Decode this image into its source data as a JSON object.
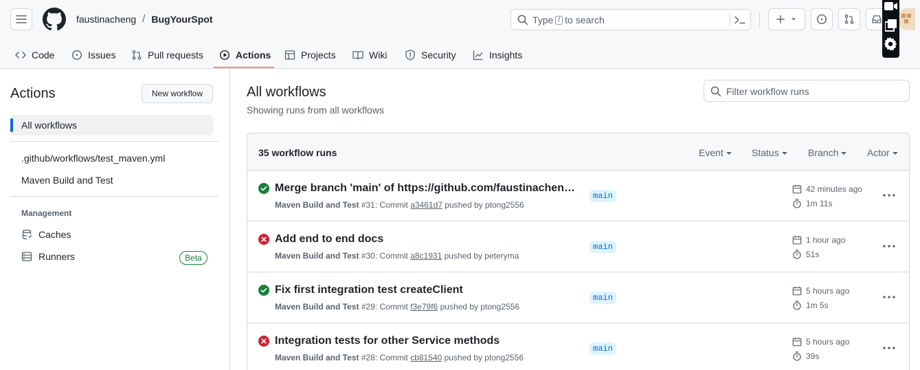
{
  "header": {
    "owner": "faustinacheng",
    "separator": "/",
    "repo": "BugYourSpot",
    "search_prefix": "Type",
    "search_key": "/",
    "search_suffix": "to search"
  },
  "tabs": [
    {
      "label": "Code",
      "icon": "code-icon"
    },
    {
      "label": "Issues",
      "icon": "issue-opened-icon"
    },
    {
      "label": "Pull requests",
      "icon": "git-pull-request-icon"
    },
    {
      "label": "Actions",
      "icon": "play-icon",
      "active": true
    },
    {
      "label": "Projects",
      "icon": "table-icon"
    },
    {
      "label": "Wiki",
      "icon": "book-icon"
    },
    {
      "label": "Security",
      "icon": "shield-icon"
    },
    {
      "label": "Insights",
      "icon": "graph-icon"
    }
  ],
  "sidebar": {
    "title": "Actions",
    "new_workflow": "New workflow",
    "all_workflows": "All workflows",
    "workflows": [
      ".github/workflows/test_maven.yml",
      "Maven Build and Test"
    ],
    "management_heading": "Management",
    "caches": "Caches",
    "runners": "Runners",
    "beta": "Beta"
  },
  "main": {
    "title": "All workflows",
    "subtitle": "Showing runs from all workflows",
    "filter_placeholder": "Filter workflow runs",
    "count": "35 workflow runs",
    "filters": [
      "Event",
      "Status",
      "Branch",
      "Actor"
    ]
  },
  "runs": [
    {
      "status": "success",
      "title": "Merge branch 'main' of https://github.com/faustinacheng/…",
      "workflow": "Maven Build and Test",
      "run_number": "#31",
      "commit_label": "Commit",
      "sha": "a3461d7",
      "pushed_by": "pushed by ptong2556",
      "branch": "main",
      "when": "42 minutes ago",
      "duration": "1m 11s"
    },
    {
      "status": "failure",
      "title": "Add end to end docs",
      "workflow": "Maven Build and Test",
      "run_number": "#30",
      "commit_label": "Commit",
      "sha": "a8c1931",
      "pushed_by": "pushed by peteryma",
      "branch": "main",
      "when": "1 hour ago",
      "duration": "51s"
    },
    {
      "status": "success",
      "title": "Fix first integration test createClient",
      "workflow": "Maven Build and Test",
      "run_number": "#29",
      "commit_label": "Commit",
      "sha": "f3e79f6",
      "pushed_by": "pushed by ptong2556",
      "branch": "main",
      "when": "5 hours ago",
      "duration": "1m 5s"
    },
    {
      "status": "failure",
      "title": "Integration tests for other Service methods",
      "workflow": "Maven Build and Test",
      "run_number": "#28",
      "commit_label": "Commit",
      "sha": "cb81540",
      "pushed_by": "pushed by ptong2556",
      "branch": "main",
      "when": "5 hours ago",
      "duration": "39s"
    }
  ],
  "colors": {
    "success": "#1a7f37",
    "failure": "#cf222e",
    "accent": "#0969da",
    "tab_underline": "#fd8c73"
  }
}
